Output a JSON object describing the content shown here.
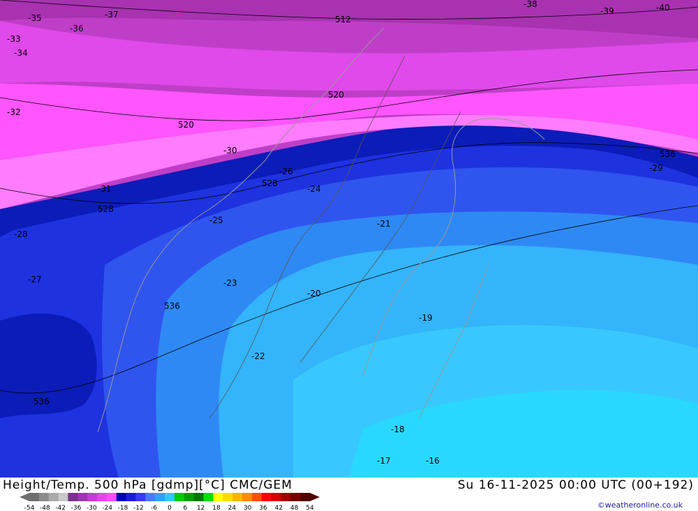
{
  "header": {
    "title": "Height/Temp. 500 hPa [gdmp][°C] CMC/GEM",
    "datetime": "Su 16-11-2025 00:00 UTC (00+192)",
    "credit": "©weatheronline.co.uk"
  },
  "scale": {
    "labels": [
      "-54",
      "-48",
      "-42",
      "-36",
      "-30",
      "-24",
      "-18",
      "-12",
      "-6",
      "0",
      "6",
      "12",
      "18",
      "24",
      "30",
      "36",
      "42",
      "48",
      "54"
    ],
    "colors": [
      "#6e6e6e",
      "#8c8c8c",
      "#aaaaaa",
      "#c8c8c8",
      "#7a2f8a",
      "#9b36b0",
      "#c13ed0",
      "#e046e8",
      "#ff4dff",
      "#0000b4",
      "#1c1cdc",
      "#3a3aff",
      "#4a7aff",
      "#33a0ff",
      "#32c8ff",
      "#00cc00",
      "#00a000",
      "#007800",
      "#00e000",
      "#ffff00",
      "#ffdc00",
      "#ffb400",
      "#ff8c00",
      "#ff5000",
      "#ff0000",
      "#d20000",
      "#a00000",
      "#780000",
      "#500000"
    ]
  },
  "map": {
    "height_labels": [
      "512",
      "520",
      "520",
      "528",
      "528",
      "536",
      "536",
      "536"
    ],
    "temp_labels": [
      "-40",
      "-39",
      "-38",
      "-37",
      "-36",
      "-35",
      "-34",
      "-33",
      "-32",
      "-31",
      "-30",
      "-29",
      "-28",
      "-27",
      "-26",
      "-25",
      "-24",
      "-23",
      "-22",
      "-21",
      "-20",
      "-19",
      "-18",
      "-17",
      "-16"
    ]
  }
}
